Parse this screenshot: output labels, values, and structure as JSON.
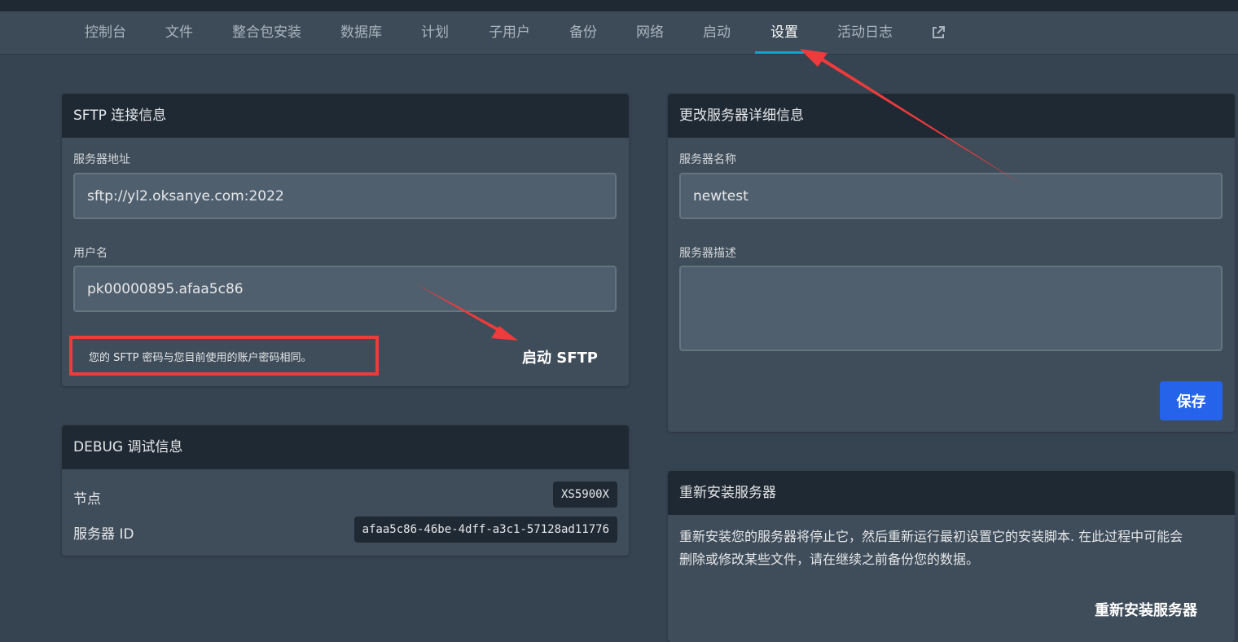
{
  "nav": {
    "items": [
      {
        "label": "控制台"
      },
      {
        "label": "文件"
      },
      {
        "label": "整合包安装"
      },
      {
        "label": "数据库"
      },
      {
        "label": "计划"
      },
      {
        "label": "子用户"
      },
      {
        "label": "备份"
      },
      {
        "label": "网络"
      },
      {
        "label": "启动"
      },
      {
        "label": "设置",
        "active": true
      },
      {
        "label": "活动日志"
      }
    ],
    "external_icon": "external-link-icon",
    "active_color": "#0ea5c6"
  },
  "sftp": {
    "title": "SFTP 连接信息",
    "address_label": "服务器地址",
    "address_value": "sftp://yl2.oksanye.com:2022",
    "username_label": "用户名",
    "username_value": "pk00000895.afaa5c86",
    "password_note": "您的 SFTP 密码与您目前使用的账户密码相同。",
    "launch_button": "启动 SFTP"
  },
  "debug": {
    "title": "DEBUG 调试信息",
    "node_label": "节点",
    "node_value": "XS5900X",
    "server_id_label": "服务器 ID",
    "server_id_value": "afaa5c86-46be-4dff-a3c1-57128ad11776"
  },
  "details": {
    "title": "更改服务器详细信息",
    "name_label": "服务器名称",
    "name_value": "newtest",
    "desc_label": "服务器描述",
    "desc_value": "",
    "save_button": "保存"
  },
  "reinstall": {
    "title": "重新安装服务器",
    "description_line1": "重新安装您的服务器将停止它，然后重新运行最初设置它的安装脚本. 在此过程中可能会",
    "description_line2": "删除或修改某些文件，请在继续之前备份您的数据。",
    "button": "重新安装服务器"
  },
  "colors": {
    "annotation_red": "#ee3b3b",
    "primary_blue": "#2563eb"
  }
}
